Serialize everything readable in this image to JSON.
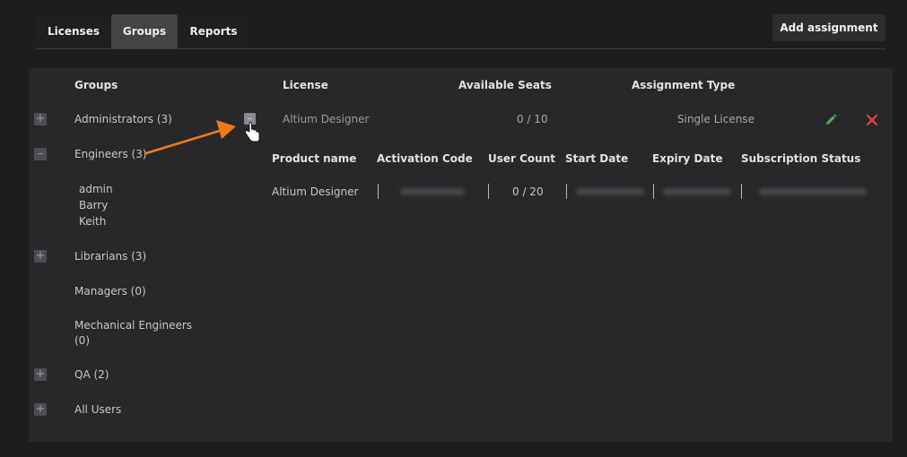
{
  "tabs": [
    {
      "label": "Licenses"
    },
    {
      "label": "Groups"
    },
    {
      "label": "Reports"
    }
  ],
  "toolbar": {
    "add_label": "Add assignment"
  },
  "groups_header": "Groups",
  "groups": [
    {
      "label": "Administrators (3)"
    },
    {
      "label": "Engineers (3)"
    },
    {
      "label": "Librarians (3)"
    },
    {
      "label": "Managers (0)"
    },
    {
      "label_line1": "Mechanical Engineers",
      "label_line2": "(0)"
    },
    {
      "label": "QA (2)"
    },
    {
      "label": "All Users"
    }
  ],
  "members": [
    "admin",
    "Barry",
    "Keith"
  ],
  "license_table": {
    "headers": {
      "license": "License",
      "seats": "Available Seats",
      "type": "Assignment Type"
    },
    "row": {
      "license": "Altium Designer",
      "seats": "0 / 10",
      "type": "Single License"
    }
  },
  "product_table": {
    "headers": {
      "product": "Product name",
      "code": "Activation Code",
      "users": "User Count",
      "start": "Start Date",
      "expiry": "Expiry Date",
      "status": "Subscription Status"
    },
    "row": {
      "product": "Altium Designer",
      "users": "0 / 20"
    }
  },
  "icons": {
    "expand": "plus-icon",
    "collapse": "minus-icon",
    "edit": "pencil-icon",
    "remove": "close-icon",
    "cursor": "hand-pointer-icon",
    "annotation": "arrow-icon"
  },
  "colors": {
    "edit_icon": "#4caf50",
    "remove_icon": "#e0453a",
    "annotation_arrow": "#f07a1a"
  }
}
